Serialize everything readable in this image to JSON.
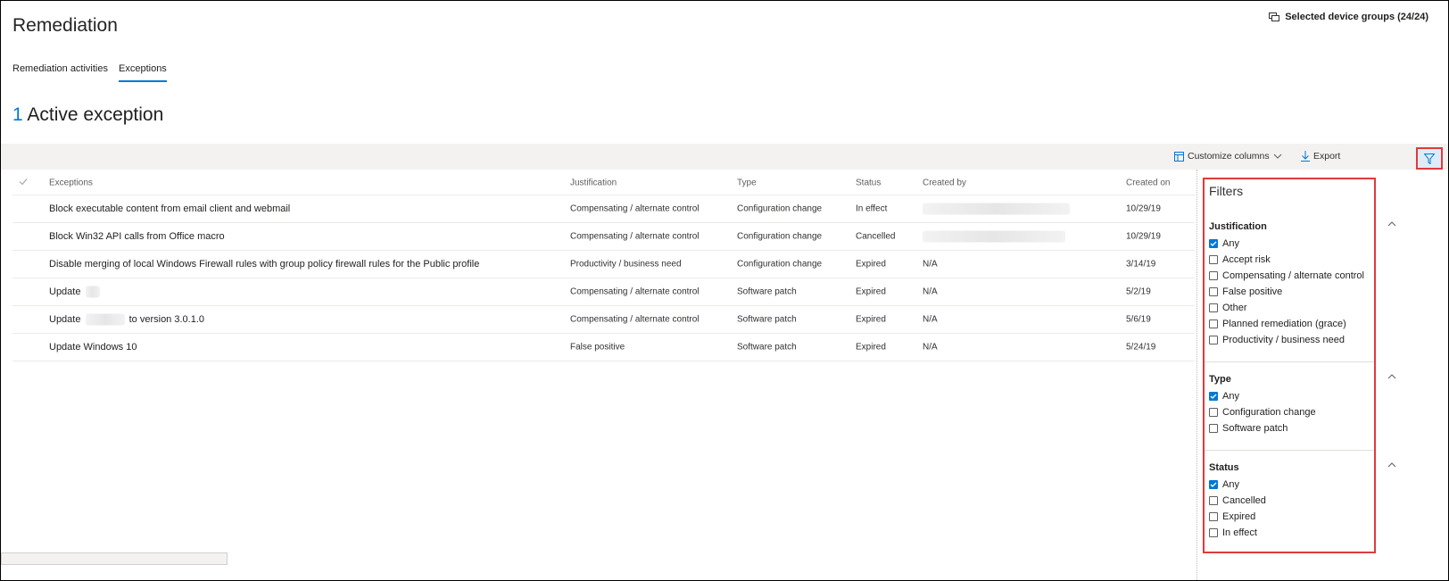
{
  "page": {
    "title": "Remediation",
    "device_groups": "Selected device groups (24/24)"
  },
  "tabs": [
    {
      "label": "Remediation activities",
      "active": false
    },
    {
      "label": "Exceptions",
      "active": true
    }
  ],
  "summary": {
    "count": "1",
    "label": "Active exception"
  },
  "toolbar": {
    "customize_label": "Customize columns",
    "export_label": "Export"
  },
  "table": {
    "headers": {
      "exceptions": "Exceptions",
      "justification": "Justification",
      "type": "Type",
      "status": "Status",
      "created_by": "Created by",
      "created_on": "Created on"
    },
    "rows": [
      {
        "exception": "Block executable content from email client and webmail",
        "justification": "Compensating / alternate control",
        "type": "Configuration change",
        "status": "In effect",
        "created_by": "",
        "created_on": "10/29/19"
      },
      {
        "exception": "Block Win32 API calls from Office macro",
        "justification": "Compensating / alternate control",
        "type": "Configuration change",
        "status": "Cancelled",
        "created_by": "",
        "created_on": "10/29/19"
      },
      {
        "exception": "Disable merging of local Windows Firewall rules with group policy firewall rules for the Public profile",
        "justification": "Productivity / business need",
        "type": "Configuration change",
        "status": "Expired",
        "created_by": "N/A",
        "created_on": "3/14/19"
      },
      {
        "exception": "Update",
        "justification": "Compensating / alternate control",
        "type": "Software patch",
        "status": "Expired",
        "created_by": "N/A",
        "created_on": "5/2/19"
      },
      {
        "exception": "Update",
        "exception_suffix": "to version 3.0.1.0",
        "justification": "Compensating / alternate control",
        "type": "Software patch",
        "status": "Expired",
        "created_by": "N/A",
        "created_on": "5/6/19"
      },
      {
        "exception": "Update Windows 10",
        "justification": "False positive",
        "type": "Software patch",
        "status": "Expired",
        "created_by": "N/A",
        "created_on": "5/24/19"
      }
    ]
  },
  "filters": {
    "title": "Filters",
    "justification": {
      "label": "Justification",
      "options": [
        {
          "label": "Any",
          "checked": true
        },
        {
          "label": "Accept risk",
          "checked": false
        },
        {
          "label": "Compensating / alternate control",
          "checked": false
        },
        {
          "label": "False positive",
          "checked": false
        },
        {
          "label": "Other",
          "checked": false
        },
        {
          "label": "Planned remediation (grace)",
          "checked": false
        },
        {
          "label": "Productivity / business need",
          "checked": false
        }
      ]
    },
    "type": {
      "label": "Type",
      "options": [
        {
          "label": "Any",
          "checked": true
        },
        {
          "label": "Configuration change",
          "checked": false
        },
        {
          "label": "Software patch",
          "checked": false
        }
      ]
    },
    "status": {
      "label": "Status",
      "options": [
        {
          "label": "Any",
          "checked": true
        },
        {
          "label": "Cancelled",
          "checked": false
        },
        {
          "label": "Expired",
          "checked": false
        },
        {
          "label": "In effect",
          "checked": false
        }
      ]
    }
  },
  "colors": {
    "accent": "#0078d4",
    "highlight": "#e03a3a"
  },
  "icons": {
    "device_groups": "device-groups-icon",
    "customize": "customize-columns-icon",
    "export": "download-icon",
    "filter": "filter-icon"
  }
}
